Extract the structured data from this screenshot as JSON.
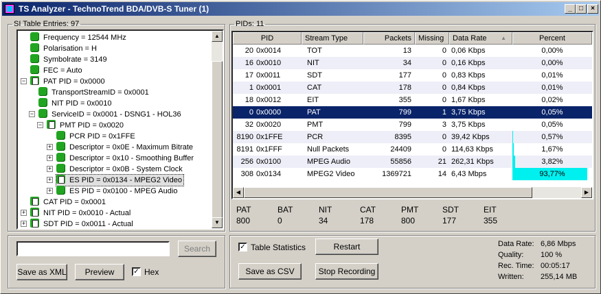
{
  "window": {
    "title": "TS Analyzer - TechnoTrend BDA/DVB-S Tuner (1)"
  },
  "left_panel": {
    "title": "SI Table Entries: 97"
  },
  "tree": [
    {
      "label": "Frequency = 12544 MHz"
    },
    {
      "label": "Polarisation = H"
    },
    {
      "label": "Symbolrate = 3149"
    },
    {
      "label": "FEC = Auto"
    },
    {
      "label": "PAT PID = 0x0000"
    },
    {
      "label": "TransportStreamID = 0x0001"
    },
    {
      "label": "NIT PID = 0x0010"
    },
    {
      "label": "ServiceID = 0x0001 - DSNG1 - HOL36"
    },
    {
      "label": "PMT PID = 0x0020"
    },
    {
      "label": "PCR PID = 0x1FFE"
    },
    {
      "label": "Descriptor = 0x0E - Maximum Bitrate"
    },
    {
      "label": "Descriptor = 0x10 - Smoothing Buffer"
    },
    {
      "label": "Descriptor = 0x0B - System Clock"
    },
    {
      "label": "ES PID = 0x0134 - MPEG2 Video"
    },
    {
      "label": "ES PID = 0x0100 - MPEG Audio"
    },
    {
      "label": "CAT PID = 0x0001"
    },
    {
      "label": "NIT PID = 0x0010 - Actual"
    },
    {
      "label": "SDT PID = 0x0011 - Actual"
    }
  ],
  "search": {
    "value": "",
    "button": "Search"
  },
  "buttons": {
    "save_xml": "Save as XML",
    "preview": "Preview",
    "hex": "Hex",
    "table_stats": "Table Statistics",
    "restart": "Restart",
    "save_csv": "Save as CSV",
    "stop_recording": "Stop Recording"
  },
  "checks": {
    "hex": "✓",
    "table_stats": "✓"
  },
  "right_panel": {
    "title": "PIDs: 11"
  },
  "columns": [
    "PID",
    "Stream Type",
    "Packets",
    "Missing",
    "Data Rate",
    "Percent"
  ],
  "sort_icon": "▲",
  "rows": [
    {
      "pid": "20",
      "hex": "0x0014",
      "type": "TOT",
      "packets": "13",
      "missing": "0",
      "rate": "0,06 Kbps",
      "percent": "0,00%",
      "pct": 0
    },
    {
      "pid": "16",
      "hex": "0x0010",
      "type": "NIT",
      "packets": "34",
      "missing": "0",
      "rate": "0,16 Kbps",
      "percent": "0,00%",
      "pct": 0
    },
    {
      "pid": "17",
      "hex": "0x0011",
      "type": "SDT",
      "packets": "177",
      "missing": "0",
      "rate": "0,83 Kbps",
      "percent": "0,01%",
      "pct": 0.01
    },
    {
      "pid": "1",
      "hex": "0x0001",
      "type": "CAT",
      "packets": "178",
      "missing": "0",
      "rate": "0,84 Kbps",
      "percent": "0,01%",
      "pct": 0.01
    },
    {
      "pid": "18",
      "hex": "0x0012",
      "type": "EIT",
      "packets": "355",
      "missing": "0",
      "rate": "1,67 Kbps",
      "percent": "0,02%",
      "pct": 0.02
    },
    {
      "pid": "0",
      "hex": "0x0000",
      "type": "PAT",
      "packets": "799",
      "missing": "1",
      "rate": "3,75 Kbps",
      "percent": "0,05%",
      "pct": 0.05
    },
    {
      "pid": "32",
      "hex": "0x0020",
      "type": "PMT",
      "packets": "799",
      "missing": "3",
      "rate": "3,75 Kbps",
      "percent": "0,05%",
      "pct": 0.05
    },
    {
      "pid": "8190",
      "hex": "0x1FFE",
      "type": "PCR",
      "packets": "8395",
      "missing": "0",
      "rate": "39,42 Kbps",
      "percent": "0,57%",
      "pct": 0.57
    },
    {
      "pid": "8191",
      "hex": "0x1FFF",
      "type": "Null Packets",
      "packets": "24409",
      "missing": "0",
      "rate": "114,63 Kbps",
      "percent": "1,67%",
      "pct": 1.67
    },
    {
      "pid": "256",
      "hex": "0x0100",
      "type": "MPEG Audio",
      "packets": "55856",
      "missing": "21",
      "rate": "262,31 Kbps",
      "percent": "3,82%",
      "pct": 3.82
    },
    {
      "pid": "308",
      "hex": "0x0134",
      "type": "MPEG2 Video",
      "packets": "1369721",
      "missing": "14",
      "rate": "6,43 Mbps",
      "percent": "93,77%",
      "pct": 93.77
    }
  ],
  "summary": [
    {
      "name": "PAT",
      "value": "800"
    },
    {
      "name": "BAT",
      "value": "0"
    },
    {
      "name": "NIT",
      "value": "34"
    },
    {
      "name": "CAT",
      "value": "178"
    },
    {
      "name": "PMT",
      "value": "800"
    },
    {
      "name": "SDT",
      "value": "177"
    },
    {
      "name": "EIT",
      "value": "355"
    }
  ],
  "info": [
    {
      "label": "Data Rate:",
      "value": "6,86 Mbps"
    },
    {
      "label": "Quality:",
      "value": "100 %"
    },
    {
      "label": "Rec. Time:",
      "value": "00:05:17"
    },
    {
      "label": "Written:",
      "value": "255,14 MB"
    }
  ]
}
